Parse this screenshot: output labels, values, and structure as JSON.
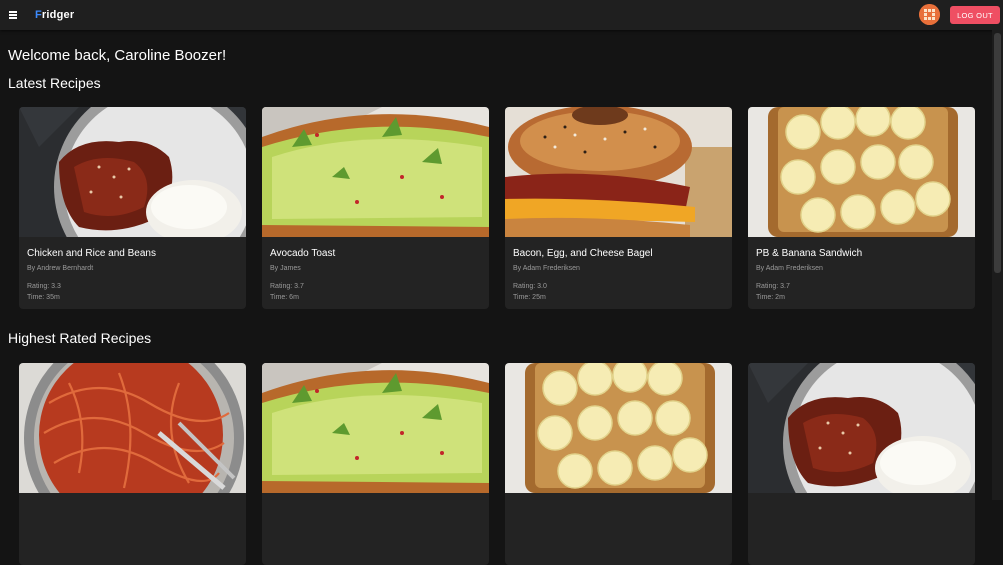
{
  "app": {
    "logo_first": "F",
    "logo_rest": "ridger",
    "logout_label": "LOG OUT"
  },
  "welcome": "Welcome back, Caroline Boozer!",
  "sections": {
    "latest_title": "Latest Recipes",
    "highest_title": "Highest Rated Recipes"
  },
  "latest": [
    {
      "title": "Chicken and Rice and Beans",
      "author": "By Andrew Bernhardt",
      "rating": "Rating: 3.3",
      "time": "Time: 35m",
      "photo": "chicken-rice-photo"
    },
    {
      "title": "Avocado Toast",
      "author": "By James",
      "rating": "Rating: 3.7",
      "time": "Time: 6m",
      "photo": "avocado-toast-photo"
    },
    {
      "title": "Bacon, Egg, and Cheese Bagel",
      "author": "By Adam Frederiksen",
      "rating": "Rating: 3.0",
      "time": "Time: 25m",
      "photo": "bagel-photo"
    },
    {
      "title": "PB & Banana Sandwich",
      "author": "By Adam Frederiksen",
      "rating": "Rating: 3.7",
      "time": "Time: 2m",
      "photo": "pb-banana-photo"
    }
  ],
  "highest": [
    {
      "photo": "spaghetti-photo"
    },
    {
      "photo": "avocado-toast-photo"
    },
    {
      "photo": "pb-banana-photo"
    },
    {
      "photo": "chicken-rice-photo"
    }
  ]
}
